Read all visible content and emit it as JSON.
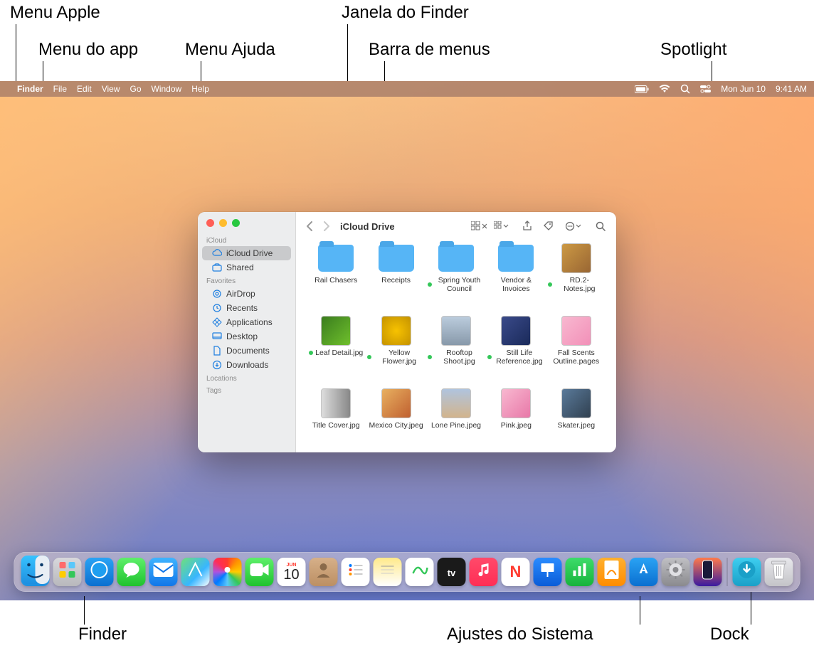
{
  "callouts": {
    "menu_apple": "Menu Apple",
    "menu_app": "Menu do app",
    "menu_ajuda": "Menu Ajuda",
    "janela_finder": "Janela do Finder",
    "barra_menus": "Barra de menus",
    "spotlight": "Spotlight",
    "finder": "Finder",
    "ajustes": "Ajustes do Sistema",
    "dock": "Dock"
  },
  "menubar": {
    "app": "Finder",
    "items": [
      "File",
      "Edit",
      "View",
      "Go",
      "Window",
      "Help"
    ],
    "status_date": "Mon Jun 10",
    "status_time": "9:41 AM"
  },
  "finder": {
    "title": "iCloud Drive",
    "sidebar": {
      "sections": [
        {
          "label": "iCloud",
          "items": [
            {
              "label": "iCloud Drive",
              "icon": "cloud",
              "selected": true
            },
            {
              "label": "Shared",
              "icon": "shared",
              "selected": false
            }
          ]
        },
        {
          "label": "Favorites",
          "items": [
            {
              "label": "AirDrop",
              "icon": "airdrop"
            },
            {
              "label": "Recents",
              "icon": "clock"
            },
            {
              "label": "Applications",
              "icon": "apps"
            },
            {
              "label": "Desktop",
              "icon": "desktop"
            },
            {
              "label": "Documents",
              "icon": "doc"
            },
            {
              "label": "Downloads",
              "icon": "download"
            }
          ]
        },
        {
          "label": "Locations",
          "items": []
        },
        {
          "label": "Tags",
          "items": []
        }
      ]
    },
    "files": [
      {
        "name": "Rail Chasers",
        "type": "folder",
        "tag": false
      },
      {
        "name": "Receipts",
        "type": "folder",
        "tag": false
      },
      {
        "name": "Spring Youth Council",
        "type": "folder",
        "tag": true
      },
      {
        "name": "Vendor & Invoices",
        "type": "folder",
        "tag": false
      },
      {
        "name": "RD.2-Notes.jpg",
        "type": "image",
        "tag": true,
        "bg": "linear-gradient(135deg,#c94,#963)"
      },
      {
        "name": "Leaf Detail.jpg",
        "type": "image",
        "tag": true,
        "bg": "linear-gradient(135deg,#3a7d1e,#6fbf2c)"
      },
      {
        "name": "Yellow Flower.jpg",
        "type": "image",
        "tag": true,
        "bg": "radial-gradient(circle,#f7c200,#c49200)"
      },
      {
        "name": "Rooftop Shoot.jpg",
        "type": "image",
        "tag": true,
        "bg": "linear-gradient(180deg,#bcd,#89a)"
      },
      {
        "name": "Still Life Reference.jpg",
        "type": "image",
        "tag": true,
        "bg": "linear-gradient(135deg,#3a4a8a,#1a2a5a)"
      },
      {
        "name": "Fall Scents Outline.pages",
        "type": "doc",
        "tag": false,
        "bg": "linear-gradient(135deg,#f8b8d0,#f290b8)"
      },
      {
        "name": "Title Cover.jpg",
        "type": "image",
        "tag": false,
        "bg": "linear-gradient(90deg,#ddd,#888)"
      },
      {
        "name": "Mexico City.jpeg",
        "type": "image",
        "tag": false,
        "bg": "linear-gradient(135deg,#e8b060,#c06030)"
      },
      {
        "name": "Lone Pine.jpeg",
        "type": "image",
        "tag": false,
        "bg": "linear-gradient(180deg,#b0c4de,#d2b48c)"
      },
      {
        "name": "Pink.jpeg",
        "type": "image",
        "tag": false,
        "bg": "linear-gradient(135deg,#f8b8d0,#e878a8)"
      },
      {
        "name": "Skater.jpeg",
        "type": "image",
        "tag": false,
        "bg": "linear-gradient(135deg,#5a7a9a,#304050)"
      }
    ]
  },
  "dock": {
    "items": [
      {
        "name": "finder",
        "bg": "linear-gradient(180deg,#37c3ff,#1e8fe0)"
      },
      {
        "name": "launchpad",
        "bg": "linear-gradient(180deg,#d8d8dc,#b8b8bc)"
      },
      {
        "name": "safari",
        "bg": "linear-gradient(180deg,#2aa3f4,#0a6fd0)"
      },
      {
        "name": "messages",
        "bg": "linear-gradient(180deg,#5ef06a,#1fc22e)"
      },
      {
        "name": "mail",
        "bg": "linear-gradient(180deg,#3fb4ff,#1176e8)"
      },
      {
        "name": "maps",
        "bg": "linear-gradient(135deg,#6fe07a,#38b6ff 60%,#fff 100%)"
      },
      {
        "name": "photos",
        "bg": "conic-gradient(#ff3b30,#ff9500,#ffcc00,#34c759,#5ac8fa,#007aff,#af52de,#ff2d55,#ff3b30)"
      },
      {
        "name": "facetime",
        "bg": "linear-gradient(180deg,#5ef06a,#1fc22e)"
      },
      {
        "name": "calendar",
        "bg": "#fff"
      },
      {
        "name": "contacts",
        "bg": "linear-gradient(180deg,#d6b089,#bc8f63)"
      },
      {
        "name": "reminders",
        "bg": "#fff"
      },
      {
        "name": "notes",
        "bg": "linear-gradient(180deg,#ffe98a,#fff)"
      },
      {
        "name": "freeform",
        "bg": "#fff"
      },
      {
        "name": "tv",
        "bg": "#1a1a1a"
      },
      {
        "name": "music",
        "bg": "linear-gradient(180deg,#ff4a6a,#ff2d55)"
      },
      {
        "name": "news",
        "bg": "#fff"
      },
      {
        "name": "keynote",
        "bg": "linear-gradient(180deg,#2a8cff,#0a5cd8)"
      },
      {
        "name": "numbers",
        "bg": "linear-gradient(180deg,#3ddc6a,#17b33c)"
      },
      {
        "name": "pages",
        "bg": "linear-gradient(180deg,#ffb02e,#ff8c00)"
      },
      {
        "name": "appstore",
        "bg": "linear-gradient(180deg,#2aa3f4,#0a6fd0)"
      },
      {
        "name": "system-settings",
        "bg": "linear-gradient(180deg,#c0c0c4,#8a8a8e)"
      },
      {
        "name": "iphone-mirroring",
        "bg": "linear-gradient(180deg,#ff7a4a,#3a1aa0)"
      }
    ],
    "right": [
      {
        "name": "downloads",
        "bg": "linear-gradient(180deg,#3ecef0,#1aa0c8)"
      },
      {
        "name": "trash",
        "bg": "linear-gradient(180deg,#e8e8ec,#c4c4c8)"
      }
    ],
    "calendar_day": "10",
    "calendar_month": "JUN"
  }
}
